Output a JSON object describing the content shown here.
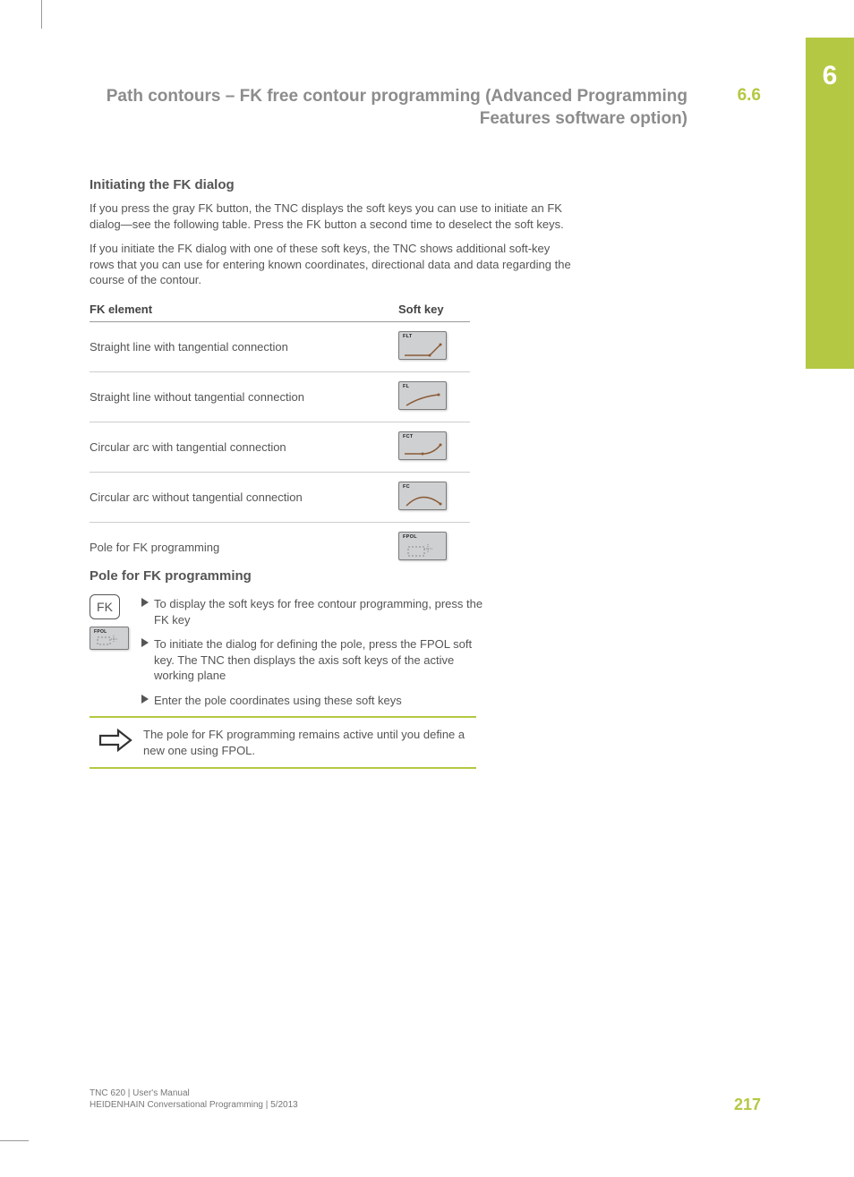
{
  "chapter_tab": "6",
  "header": {
    "title": "Path contours – FK free contour programming (Advanced Programming Features software option)",
    "section_number": "6.6"
  },
  "section1": {
    "heading": "Initiating the FK dialog",
    "p1": "If you press the gray FK button, the TNC displays the soft keys you can use to initiate an FK dialog—see the following table. Press the FK button a second time to deselect the soft keys.",
    "p2": "If you initiate the FK dialog with one of these soft keys, the TNC shows additional soft-key rows that you can use for entering known coordinates, directional data and data regarding the course of the contour."
  },
  "table": {
    "col1": "FK element",
    "col2": "Soft key",
    "rows": [
      {
        "label": "Straight line with tangential connection",
        "key": "FLT"
      },
      {
        "label": "Straight line without tangential connection",
        "key": "FL"
      },
      {
        "label": "Circular arc with tangential connection",
        "key": "FCT"
      },
      {
        "label": "Circular arc without tangential connection",
        "key": "FC"
      },
      {
        "label": "Pole for FK programming",
        "key": "FPOL"
      }
    ]
  },
  "section2": {
    "heading": "Pole for FK programming",
    "hardkey": "FK",
    "stack_softkey": "FPOL",
    "steps": [
      "To display the soft keys for free contour programming, press the FK key",
      "To initiate the dialog for defining the pole, press the FPOL soft key. The TNC then displays the axis soft keys of the active working plane",
      "Enter the pole coordinates using these soft keys"
    ],
    "note": "The pole for FK programming remains active until you define a new one using FPOL."
  },
  "footer": {
    "line1": "TNC 620 | User's Manual",
    "line2": "HEIDENHAIN Conversational Programming | 5/2013",
    "page": "217"
  }
}
